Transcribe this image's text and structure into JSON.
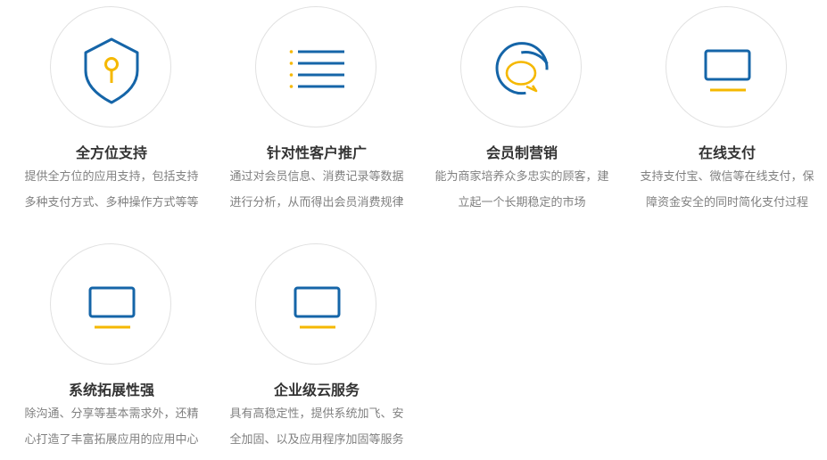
{
  "colors": {
    "blue": "#1565a8",
    "yellow": "#f5b800",
    "circle_border": "#e1e1e1",
    "title": "#333333",
    "desc": "#808080"
  },
  "features": [
    {
      "icon": "shield-key-icon",
      "title": "全方位支持",
      "desc_line1": "提供全方位的应用支持，包括支持",
      "desc_line2": "多种支付方式、多种操作方式等等"
    },
    {
      "icon": "list-icon",
      "title": "针对性客户推广",
      "desc_line1": "通过对会员信息、消费记录等数据",
      "desc_line2": "进行分析，从而得出会员消费规律"
    },
    {
      "icon": "chat-bubble-icon",
      "title": "会员制营销",
      "desc_line1": "能为商家培养众多忠实的顾客，建",
      "desc_line2": "立起一个长期稳定的市场"
    },
    {
      "icon": "monitor-icon",
      "title": "在线支付",
      "desc_line1": "支持支付宝、微信等在线支付，保",
      "desc_line2": "障资金安全的同时简化支付过程"
    },
    {
      "icon": "monitor-icon",
      "title": "系统拓展性强",
      "desc_line1": "除沟通、分享等基本需求外，还精",
      "desc_line2": "心打造了丰富拓展应用的应用中心"
    },
    {
      "icon": "monitor-icon",
      "title": "企业级云服务",
      "desc_line1": "具有高稳定性，提供系统加飞、安",
      "desc_line2": "全加固、以及应用程序加固等服务"
    }
  ]
}
